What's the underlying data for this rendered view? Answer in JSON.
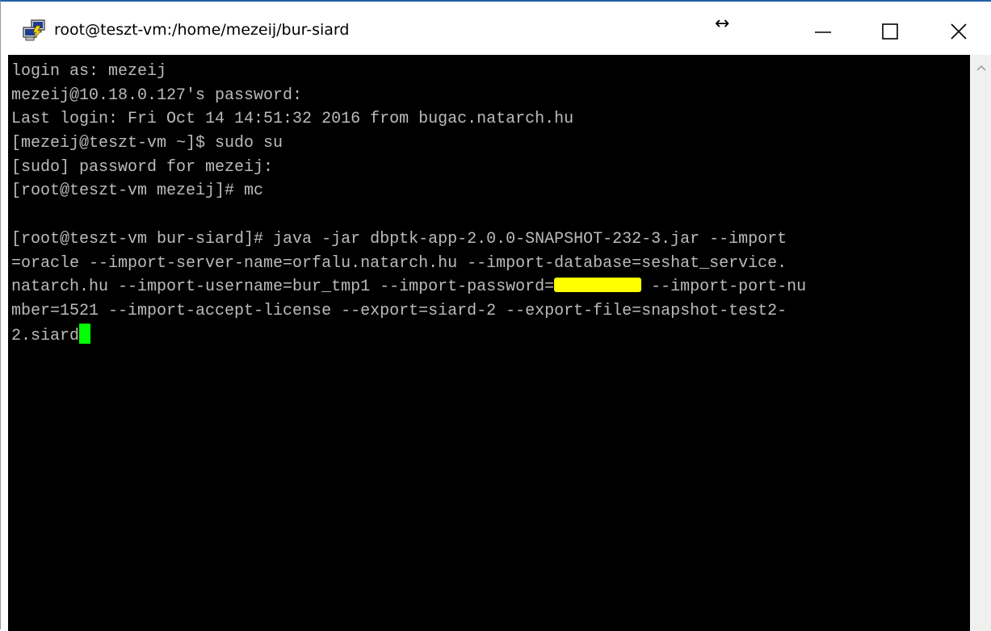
{
  "window": {
    "title": "root@teszt-vm:/home/mezeij/bur-siard",
    "resize_glyph": "↔",
    "icons": {
      "app": "putty-computers-icon",
      "minimize": "minimize-icon",
      "maximize": "maximize-icon",
      "close": "close-icon",
      "scroll_up": "chevron-up-icon"
    }
  },
  "terminal": {
    "colors": {
      "background": "#000000",
      "foreground": "#bbbbbb",
      "cursor": "#00ff00",
      "redaction": "#ffff00"
    },
    "lines": [
      "login as: mezeij",
      "mezeij@10.18.0.127's password:",
      "Last login: Fri Oct 14 14:51:32 2016 from bugac.natarch.hu",
      "[mezeij@teszt-vm ~]$ sudo su",
      "[sudo] password for mezeij:",
      "[root@teszt-vm mezeij]# mc",
      "",
      "[root@teszt-vm bur-siard]# java -jar dbptk-app-2.0.0-SNAPSHOT-232-3.jar --import",
      "=oracle --import-server-name=orfalu.natarch.hu --import-database=seshat_service.",
      "natarch.hu --import-username=bur_tmp1 --import-password=",
      " --import-port-nu",
      "mber=1521 --import-accept-license --export=siard-2 --export-file=snapshot-test2-",
      "2.siard"
    ]
  }
}
